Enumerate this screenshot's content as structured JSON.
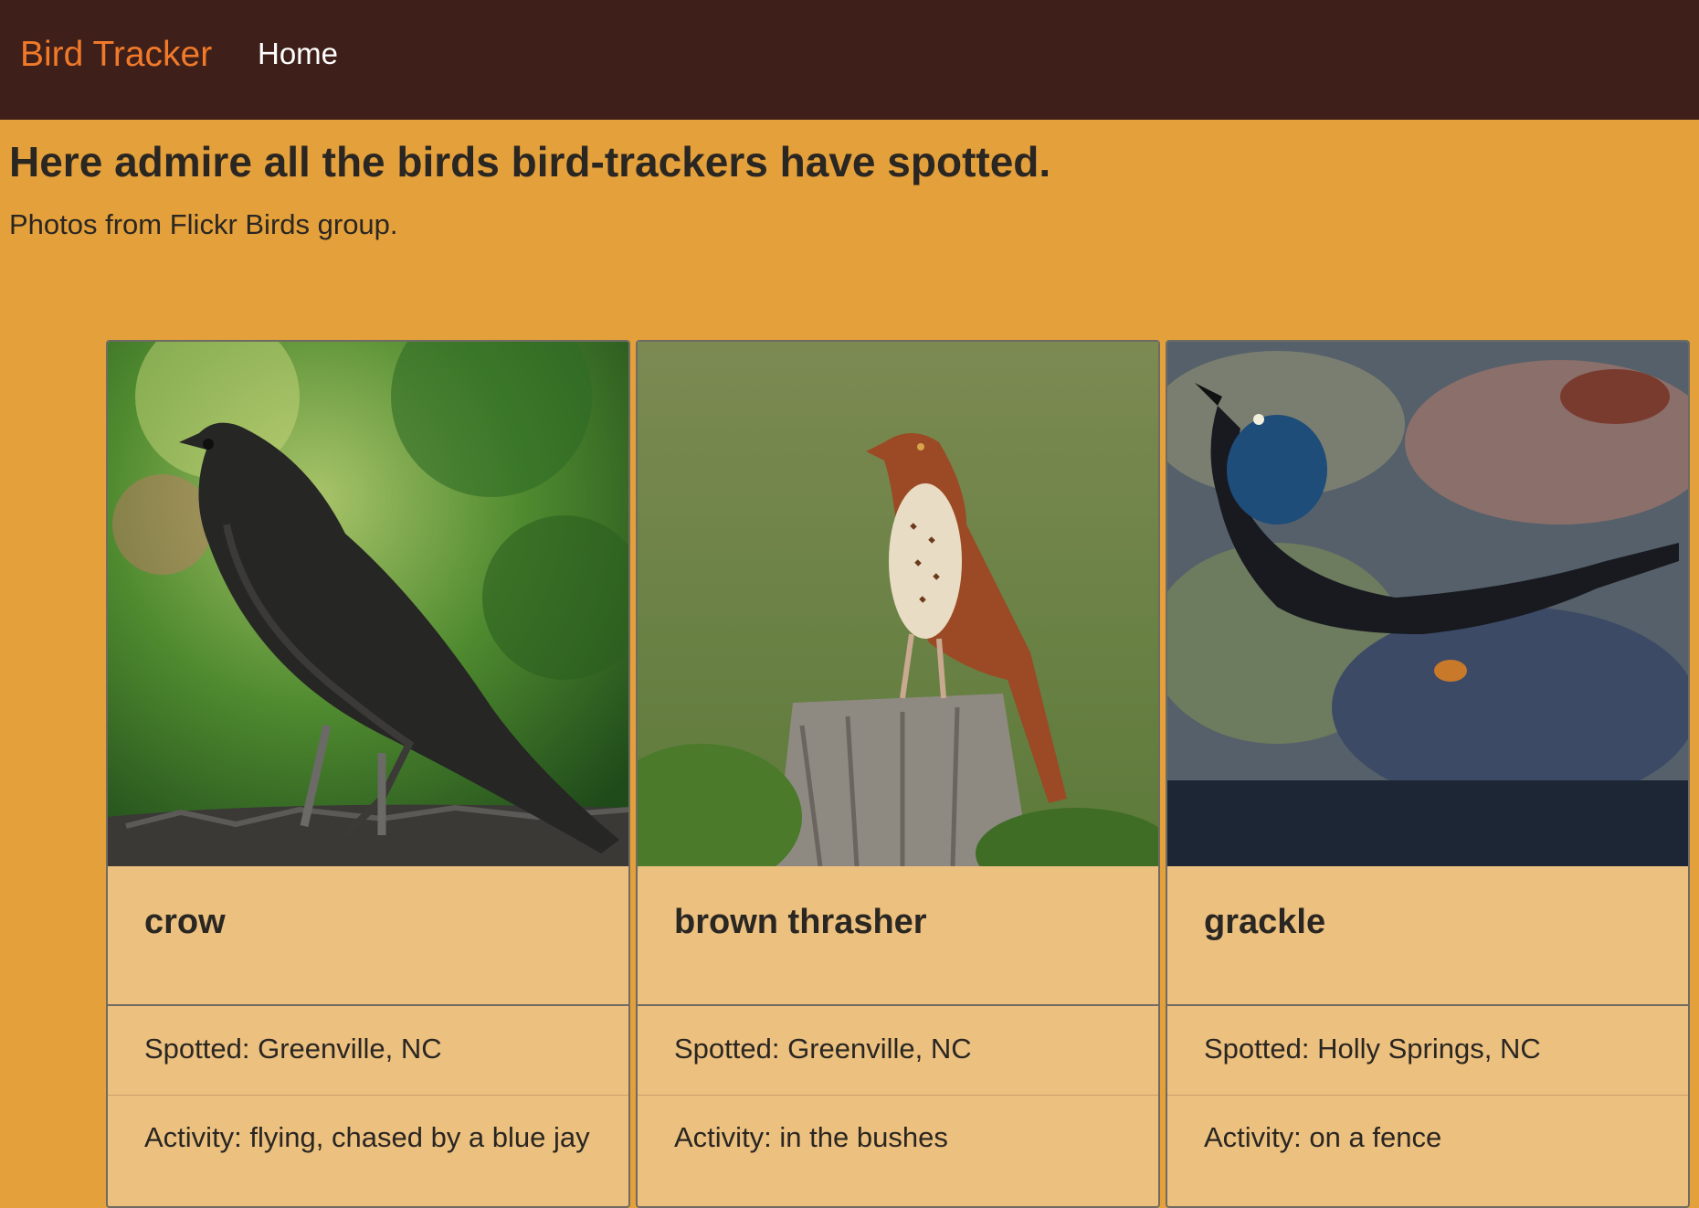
{
  "navbar": {
    "brand": "Bird Tracker",
    "links": [
      {
        "label": "Home"
      }
    ]
  },
  "main": {
    "heading": "Here admire all the birds bird-trackers have spotted.",
    "subtext": "Photos from Flickr Birds group."
  },
  "cards": [
    {
      "name": "crow",
      "spotted": "Spotted: Greenville, NC",
      "activity": "Activity: flying, chased by a blue jay",
      "photo": "crow perched on a stump"
    },
    {
      "name": "brown thrasher",
      "spotted": "Spotted: Greenville, NC",
      "activity": "Activity: in the bushes",
      "photo": "brown thrasher perched on a post"
    },
    {
      "name": "grackle",
      "spotted": "Spotted: Holly Springs, NC",
      "activity": "Activity: on a fence",
      "photo": "grackle standing on mossy rocks"
    }
  ],
  "colors": {
    "navbar_bg": "#3e1f19",
    "brand": "#f07a2a",
    "page_bg": "#e4a03b",
    "card_bg": "#ecc07f"
  }
}
